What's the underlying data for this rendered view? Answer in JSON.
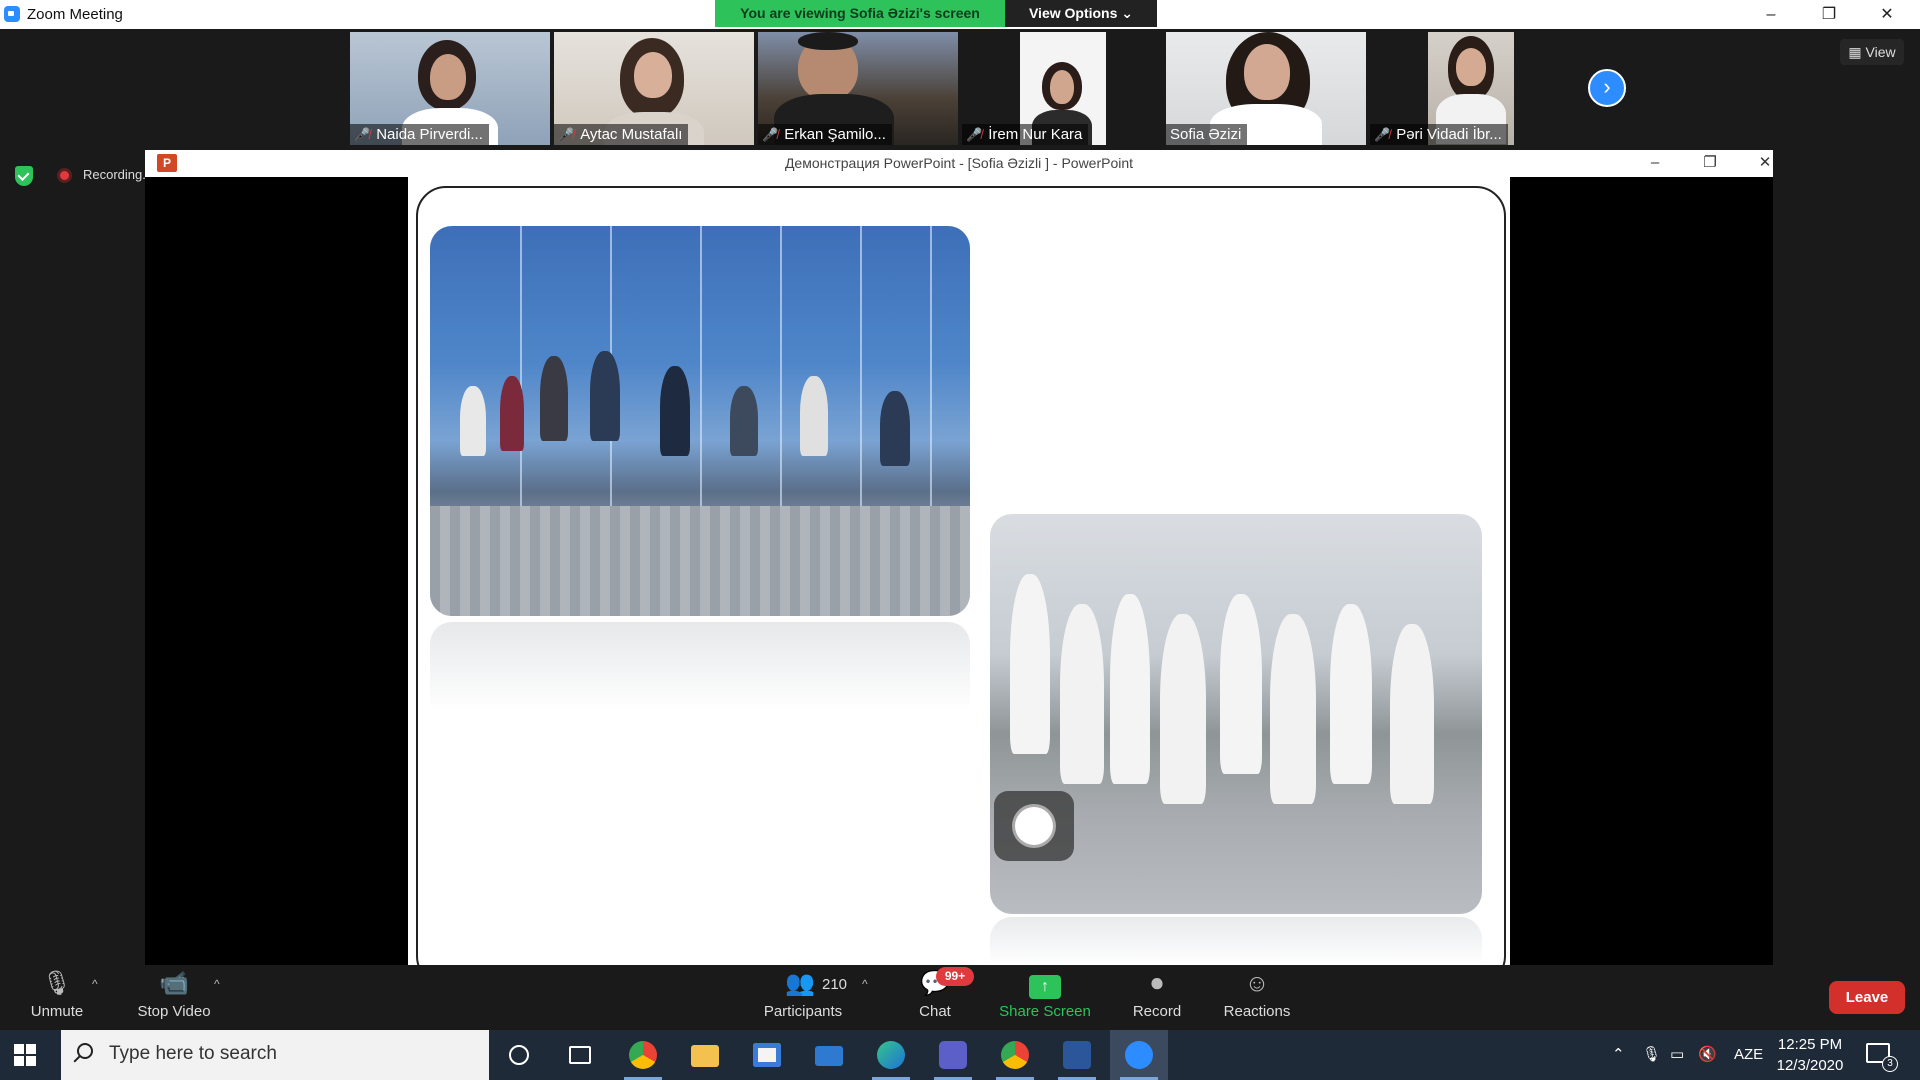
{
  "window": {
    "title": "Zoom Meeting",
    "controls": {
      "minimize": "–",
      "restore": "❐",
      "close": "✕"
    }
  },
  "share_banner": {
    "text": "You are viewing Sofia Əzizi's screen",
    "view_options": "View Options ⌄",
    "color": "#2ec25b"
  },
  "participants_strip": {
    "thumbnails": [
      {
        "name": "Naida Pirverdi...",
        "muted": true,
        "active": false
      },
      {
        "name": "Aytac Mustafalı",
        "muted": true,
        "active": false
      },
      {
        "name": "Erkan Şamilo...",
        "muted": true,
        "active": false
      },
      {
        "name": "İrem Nur Kara",
        "muted": true,
        "active": false
      },
      {
        "name": "Sofia Əzizi",
        "muted": false,
        "active": true
      },
      {
        "name": "Pəri Vidadi İbr...",
        "muted": true,
        "active": false
      }
    ],
    "next_icon": "›",
    "view_label": "View"
  },
  "status": {
    "recording_label": "Recording..."
  },
  "shared_window": {
    "title": "Демонстрация PowerPoint - [Sofia Əzizli ] - PowerPoint",
    "icon_letter": "P",
    "controls": {
      "minimize": "–",
      "restore": "❐",
      "close": "✕"
    }
  },
  "toolbar": {
    "unmute": "Unmute",
    "stop_video": "Stop Video",
    "participants": "Participants",
    "participants_count": "210",
    "chat": "Chat",
    "chat_badge": "99+",
    "share_screen": "Share Screen",
    "record": "Record",
    "reactions": "Reactions",
    "leave": "Leave",
    "caret": "^"
  },
  "taskbar": {
    "search_placeholder": "Type here to search",
    "language": "AZE",
    "time": "12:25 PM",
    "date": "12/3/2020",
    "notification_count": "3"
  },
  "colors": {
    "accent_blue": "#2d8cff",
    "leave_red": "#d4302b",
    "muted_red": "#e0393e"
  }
}
